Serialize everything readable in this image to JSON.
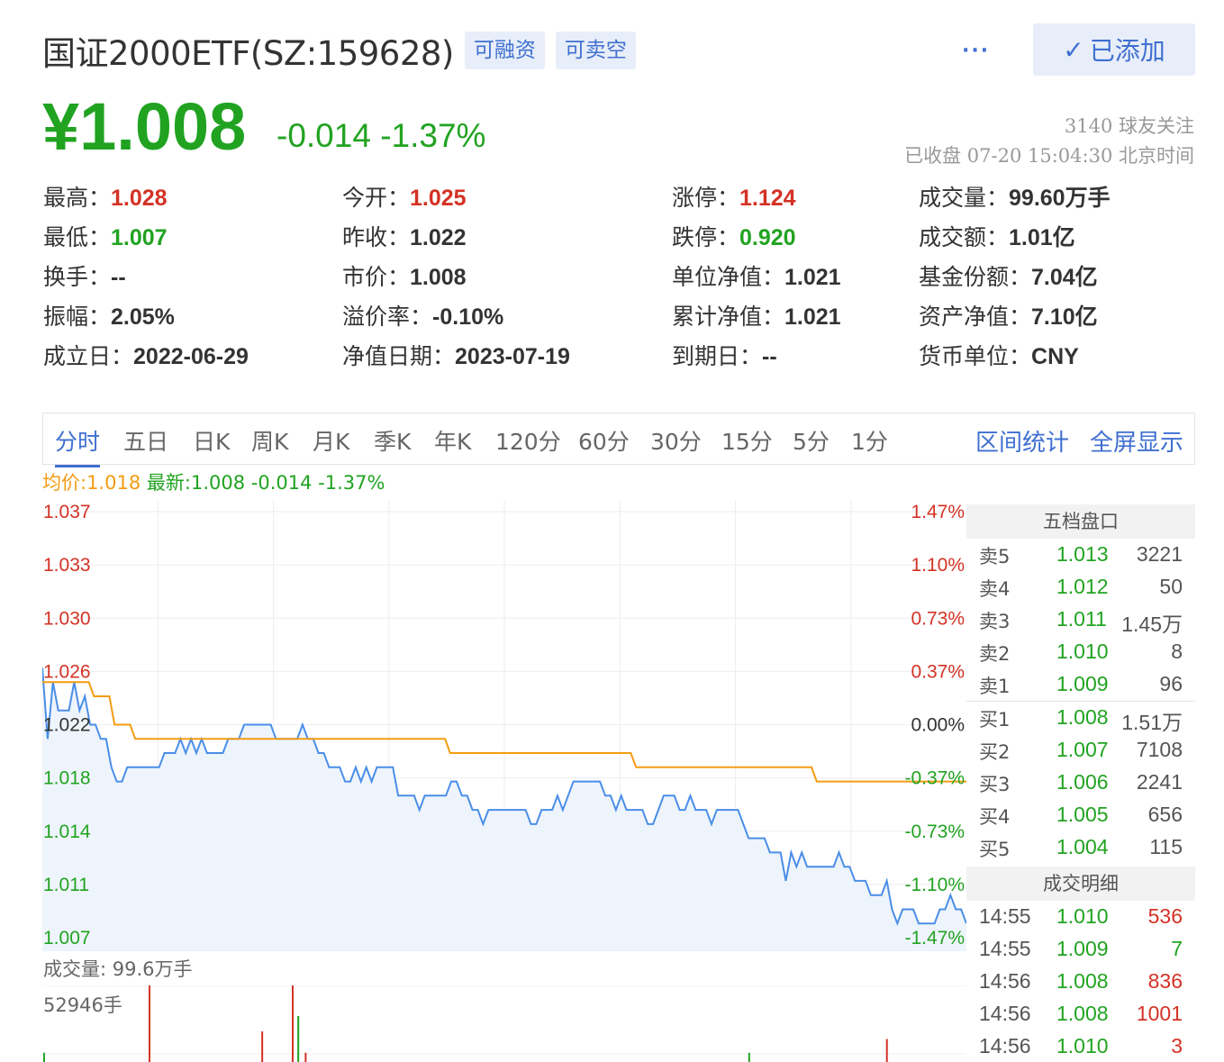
{
  "header": {
    "title": "国证2000ETF(SZ:159628)",
    "tags": [
      "可融资",
      "可卖空"
    ],
    "more_icon": "···",
    "added_label": "已添加",
    "added_icon": "✓"
  },
  "quote": {
    "price": "¥1.008",
    "change": "-0.014",
    "change_pct": "-1.37%",
    "followers": "3140 球友关注",
    "status": "已收盘 07-20 15:04:30 北京时间"
  },
  "stats": [
    {
      "label": "最高：",
      "value": "1.028",
      "color": "red"
    },
    {
      "label": "今开：",
      "value": "1.025",
      "color": "red"
    },
    {
      "label": "涨停：",
      "value": "1.124",
      "color": "red"
    },
    {
      "label": "成交量：",
      "value": "99.60万手",
      "color": "default"
    },
    {
      "label": "最低：",
      "value": "1.007",
      "color": "green"
    },
    {
      "label": "昨收：",
      "value": "1.022",
      "color": "default"
    },
    {
      "label": "跌停：",
      "value": "0.920",
      "color": "green"
    },
    {
      "label": "成交额：",
      "value": "1.01亿",
      "color": "default"
    },
    {
      "label": "换手：",
      "value": "--",
      "color": "default"
    },
    {
      "label": "市价：",
      "value": "1.008",
      "color": "default"
    },
    {
      "label": "单位净值：",
      "value": "1.021",
      "color": "default"
    },
    {
      "label": "基金份额：",
      "value": "7.04亿",
      "color": "default"
    },
    {
      "label": "振幅：",
      "value": "2.05%",
      "color": "default"
    },
    {
      "label": "溢价率：",
      "value": "-0.10%",
      "color": "default"
    },
    {
      "label": "累计净值：",
      "value": "1.021",
      "color": "default"
    },
    {
      "label": "资产净值：",
      "value": "7.10亿",
      "color": "default"
    },
    {
      "label": "成立日：",
      "value": "2022-06-29",
      "color": "default"
    },
    {
      "label": "净值日期：",
      "value": "2023-07-19",
      "color": "default"
    },
    {
      "label": "到期日：",
      "value": "--",
      "color": "default"
    },
    {
      "label": "货币单位：",
      "value": "CNY",
      "color": "default"
    }
  ],
  "tabs": [
    "分时",
    "五日",
    "日K",
    "周K",
    "月K",
    "季K",
    "年K",
    "120分",
    "60分",
    "30分",
    "15分",
    "5分",
    "1分"
  ],
  "active_tab": "分时",
  "tab_actions": [
    "区间统计",
    "全屏显示"
  ],
  "legend": {
    "avg": "均价:1.018",
    "latest": "最新:1.008 -0.014 -1.37%"
  },
  "colors": {
    "up": "#d33225",
    "down": "#21a321",
    "price_line": "#4a8ee8",
    "avg_line": "#f39c12",
    "accent": "#3f6fd0"
  },
  "chart_data": {
    "type": "line",
    "y_left_ticks": [
      "1.037",
      "1.033",
      "1.030",
      "1.026",
      "1.022",
      "1.018",
      "1.014",
      "1.011",
      "1.007"
    ],
    "y_right_ticks": [
      "1.47%",
      "1.10%",
      "0.73%",
      "0.37%",
      "0.00%",
      "-0.37%",
      "-0.73%",
      "-1.10%",
      "-1.47%"
    ],
    "ylim": [
      1.007,
      1.037
    ],
    "prev_close": 1.022,
    "series": [
      {
        "values": [
          1.026,
          1.021,
          1.025,
          1.023,
          1.023,
          1.023,
          1.025,
          1.023,
          1.024,
          1.022,
          1.022,
          1.021,
          1.021,
          1.019,
          1.018,
          1.018,
          1.019,
          1.019,
          1.019,
          1.019,
          1.019,
          1.019,
          1.019,
          1.02,
          1.02,
          1.02,
          1.021,
          1.02,
          1.021,
          1.02,
          1.021,
          1.02,
          1.02,
          1.02,
          1.02,
          1.021,
          1.021,
          1.021,
          1.022,
          1.022,
          1.022,
          1.022,
          1.022,
          1.022,
          1.021,
          1.021,
          1.021,
          1.021,
          1.021,
          1.022,
          1.021,
          1.021,
          1.02,
          1.02,
          1.019,
          1.019,
          1.019,
          1.018,
          1.018,
          1.019,
          1.018,
          1.019,
          1.018,
          1.019,
          1.019,
          1.019,
          1.019,
          1.017,
          1.017,
          1.017,
          1.017,
          1.016,
          1.017,
          1.017,
          1.017,
          1.017,
          1.017,
          1.018,
          1.018,
          1.017,
          1.017,
          1.016,
          1.016,
          1.015,
          1.016,
          1.016,
          1.016,
          1.016,
          1.016,
          1.016,
          1.016,
          1.016,
          1.015,
          1.015,
          1.016,
          1.016,
          1.016,
          1.017,
          1.016,
          1.017,
          1.018,
          1.018,
          1.018,
          1.018,
          1.018,
          1.018,
          1.017,
          1.017,
          1.016,
          1.017,
          1.016,
          1.016,
          1.016,
          1.016,
          1.015,
          1.015,
          1.016,
          1.017,
          1.017,
          1.017,
          1.016,
          1.016,
          1.017,
          1.016,
          1.016,
          1.016,
          1.015,
          1.016,
          1.016,
          1.016,
          1.016,
          1.016,
          1.015,
          1.014,
          1.014,
          1.014,
          1.014,
          1.013,
          1.013,
          1.013,
          1.011,
          1.013,
          1.012,
          1.013,
          1.012,
          1.012,
          1.012,
          1.012,
          1.012,
          1.012,
          1.013,
          1.012,
          1.012,
          1.011,
          1.011,
          1.011,
          1.01,
          1.01,
          1.01,
          1.011,
          1.009,
          1.008,
          1.009,
          1.009,
          1.009,
          1.008,
          1.008,
          1.008,
          1.008,
          1.009,
          1.009,
          1.01,
          1.009,
          1.009,
          1.008
        ]
      },
      {
        "values": [
          1.025,
          1.025,
          1.025,
          1.025,
          1.025,
          1.025,
          1.025,
          1.025,
          1.025,
          1.025,
          1.024,
          1.024,
          1.024,
          1.024,
          1.022,
          1.022,
          1.022,
          1.022,
          1.021,
          1.021,
          1.021,
          1.021,
          1.021,
          1.021,
          1.021,
          1.021,
          1.021,
          1.021,
          1.021,
          1.021,
          1.021,
          1.021,
          1.021,
          1.021,
          1.021,
          1.021,
          1.021,
          1.021,
          1.021,
          1.021,
          1.021,
          1.021,
          1.021,
          1.021,
          1.021,
          1.021,
          1.021,
          1.021,
          1.021,
          1.021,
          1.021,
          1.021,
          1.021,
          1.021,
          1.021,
          1.021,
          1.021,
          1.021,
          1.021,
          1.021,
          1.021,
          1.021,
          1.021,
          1.021,
          1.021,
          1.021,
          1.021,
          1.021,
          1.021,
          1.021,
          1.021,
          1.021,
          1.021,
          1.021,
          1.021,
          1.021,
          1.021,
          1.021,
          1.021,
          1.02,
          1.02,
          1.02,
          1.02,
          1.02,
          1.02,
          1.02,
          1.02,
          1.02,
          1.02,
          1.02,
          1.02,
          1.02,
          1.02,
          1.02,
          1.02,
          1.02,
          1.02,
          1.02,
          1.02,
          1.02,
          1.02,
          1.02,
          1.02,
          1.02,
          1.02,
          1.02,
          1.02,
          1.02,
          1.02,
          1.02,
          1.02,
          1.02,
          1.02,
          1.02,
          1.02,
          1.019,
          1.019,
          1.019,
          1.019,
          1.019,
          1.019,
          1.019,
          1.019,
          1.019,
          1.019,
          1.019,
          1.019,
          1.019,
          1.019,
          1.019,
          1.019,
          1.019,
          1.019,
          1.019,
          1.019,
          1.019,
          1.019,
          1.019,
          1.019,
          1.019,
          1.019,
          1.019,
          1.019,
          1.019,
          1.019,
          1.019,
          1.019,
          1.019,
          1.019,
          1.019,
          1.018,
          1.018,
          1.018,
          1.018,
          1.018,
          1.018,
          1.018,
          1.018,
          1.018,
          1.018,
          1.018,
          1.018,
          1.018,
          1.018,
          1.018,
          1.018,
          1.018,
          1.018,
          1.018,
          1.018,
          1.018,
          1.018,
          1.018,
          1.018,
          1.018,
          1.018,
          1.018,
          1.018,
          1.018,
          1.018
        ]
      }
    ],
    "volume_label": "成交量: 99.6万手",
    "volume_max_label": "52946手",
    "volume_bars": [
      {
        "x": 0.0,
        "v": 0.12,
        "c": "green"
      },
      {
        "x": 0.114,
        "v": 1.0,
        "c": "red"
      },
      {
        "x": 0.236,
        "v": 0.4,
        "c": "red"
      },
      {
        "x": 0.269,
        "v": 1.0,
        "c": "red"
      },
      {
        "x": 0.275,
        "v": 0.6,
        "c": "green"
      },
      {
        "x": 0.283,
        "v": 0.12,
        "c": "red"
      },
      {
        "x": 0.763,
        "v": 0.12,
        "c": "green"
      },
      {
        "x": 0.912,
        "v": 0.3,
        "c": "red"
      }
    ]
  },
  "order_book": {
    "title": "五档盘口",
    "asks": [
      {
        "label": "卖5",
        "price": "1.013",
        "qty": "3221"
      },
      {
        "label": "卖4",
        "price": "1.012",
        "qty": "50"
      },
      {
        "label": "卖3",
        "price": "1.011",
        "qty": "1.45万"
      },
      {
        "label": "卖2",
        "price": "1.010",
        "qty": "8"
      },
      {
        "label": "卖1",
        "price": "1.009",
        "qty": "96"
      }
    ],
    "bids": [
      {
        "label": "买1",
        "price": "1.008",
        "qty": "1.51万"
      },
      {
        "label": "买2",
        "price": "1.007",
        "qty": "7108"
      },
      {
        "label": "买3",
        "price": "1.006",
        "qty": "2241"
      },
      {
        "label": "买4",
        "price": "1.005",
        "qty": "656"
      },
      {
        "label": "买5",
        "price": "1.004",
        "qty": "115"
      }
    ]
  },
  "trades": {
    "title": "成交明细",
    "rows": [
      {
        "time": "14:55",
        "price": "1.010",
        "qty": "536",
        "color": "red"
      },
      {
        "time": "14:55",
        "price": "1.009",
        "qty": "7",
        "color": "green"
      },
      {
        "time": "14:56",
        "price": "1.008",
        "qty": "836",
        "color": "red"
      },
      {
        "time": "14:56",
        "price": "1.008",
        "qty": "1001",
        "color": "red"
      },
      {
        "time": "14:56",
        "price": "1.010",
        "qty": "3",
        "color": "red"
      }
    ]
  }
}
